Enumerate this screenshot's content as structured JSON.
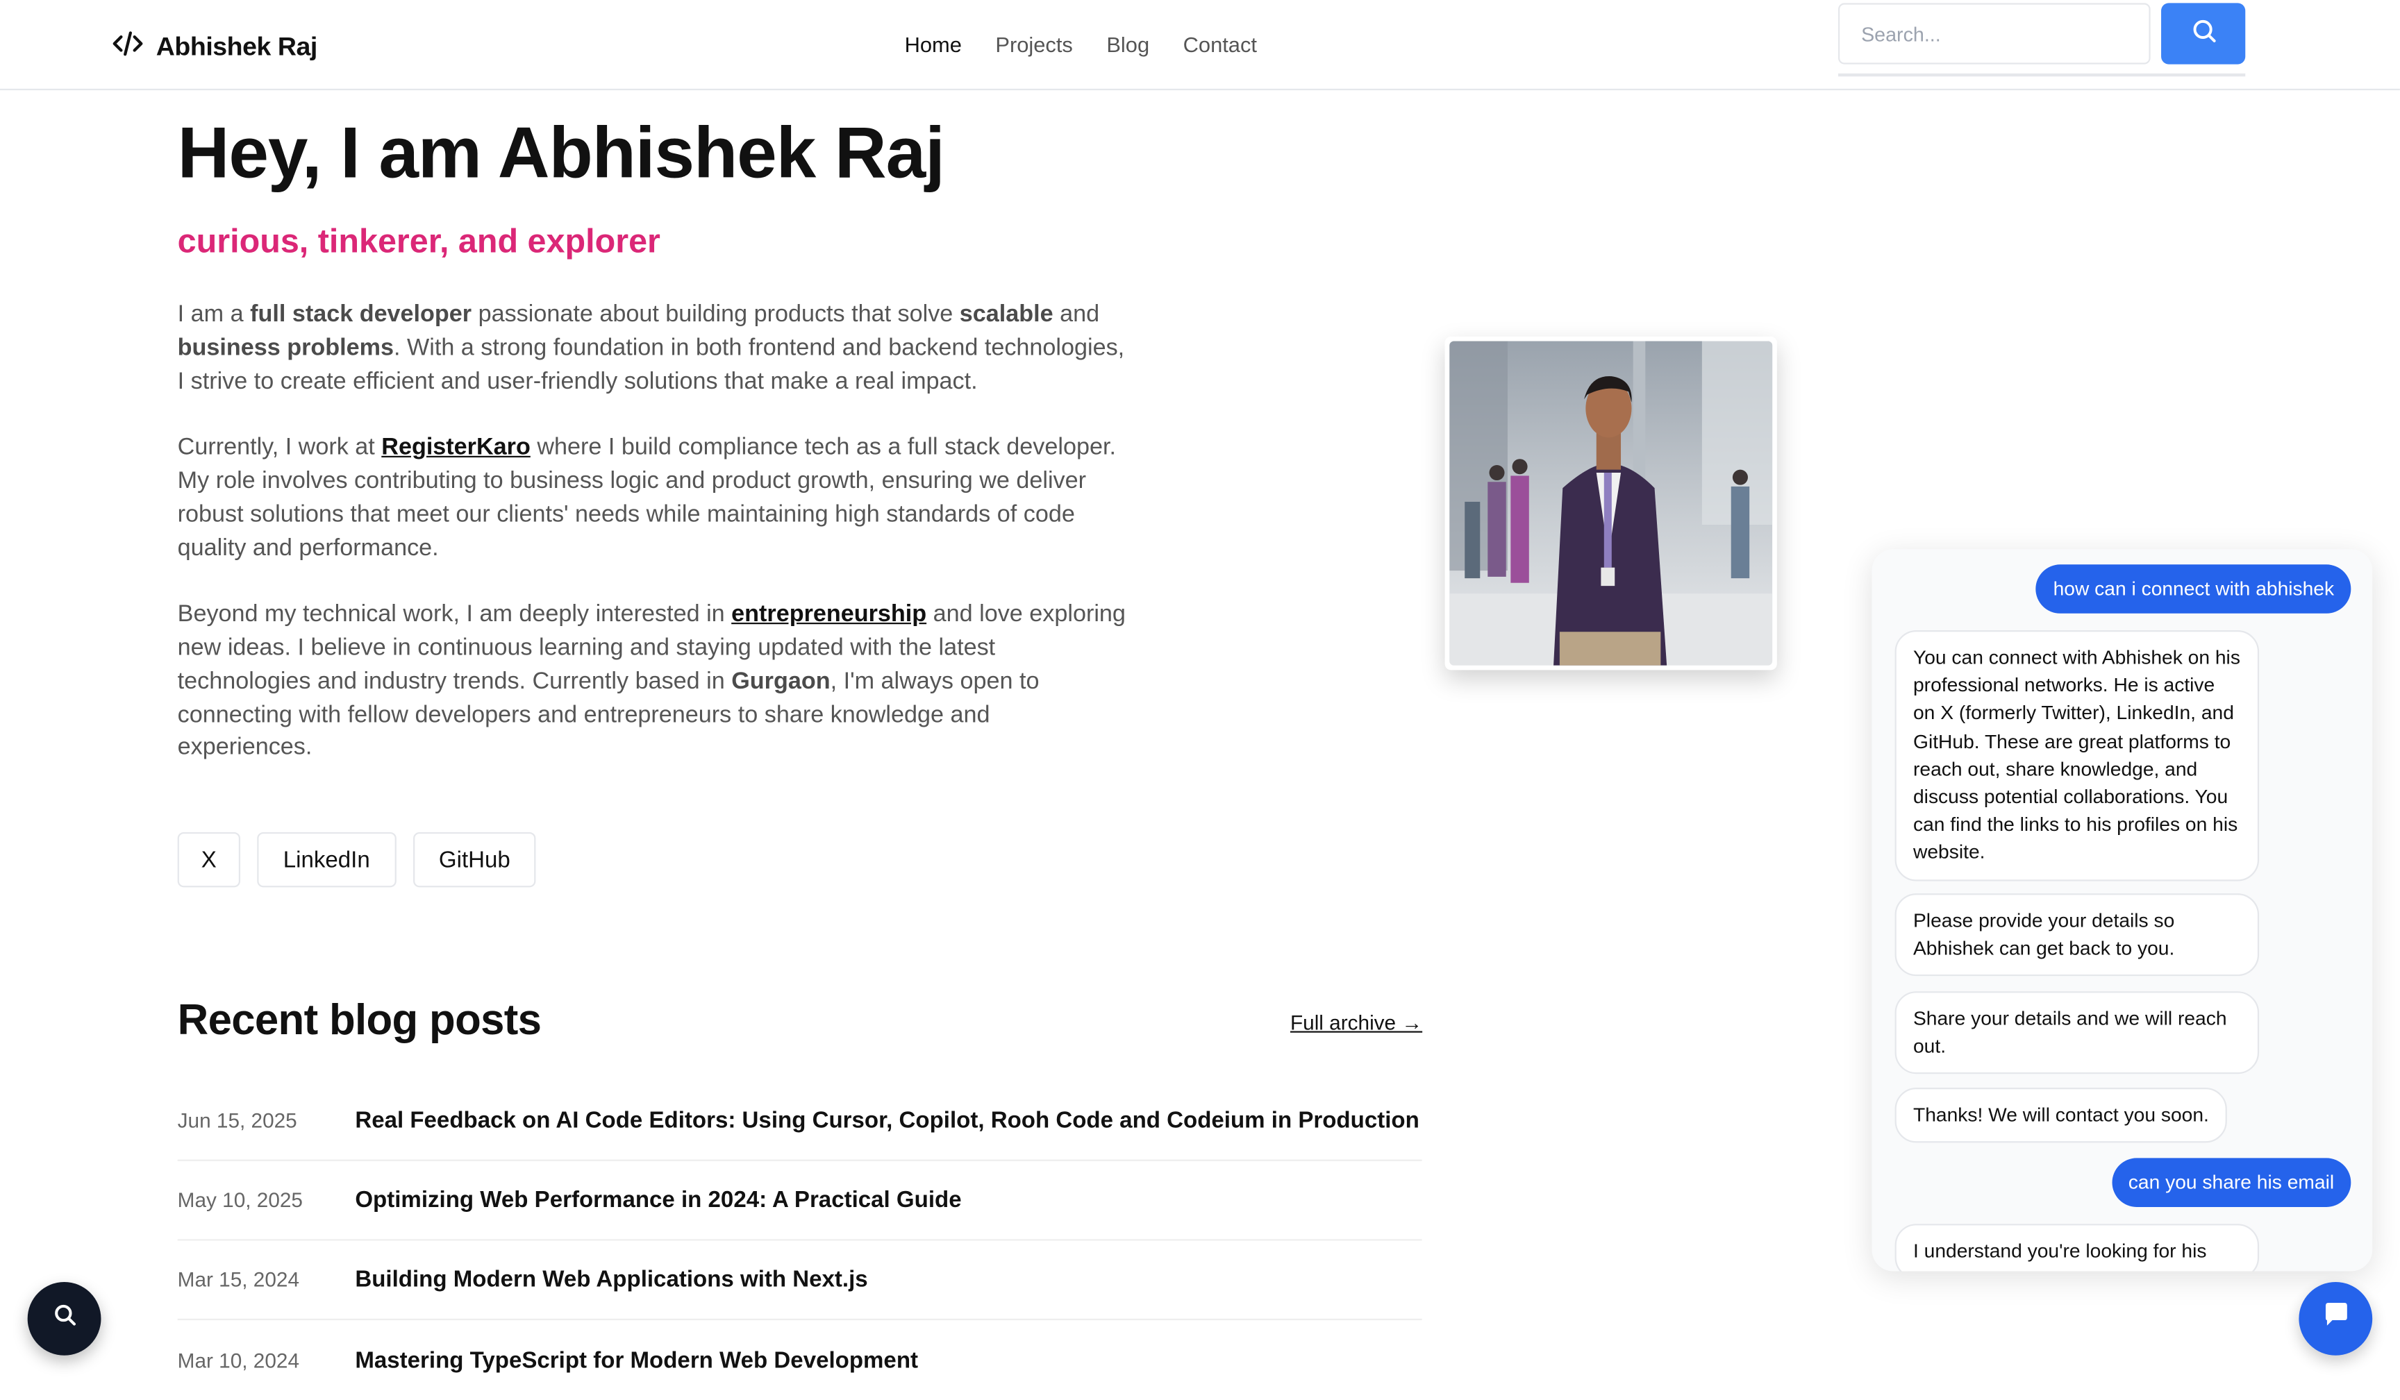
{
  "header": {
    "brand_name": "Abhishek Raj",
    "nav": [
      {
        "label": "Home",
        "active": true
      },
      {
        "label": "Projects",
        "active": false
      },
      {
        "label": "Blog",
        "active": false
      },
      {
        "label": "Contact",
        "active": false
      }
    ],
    "search_placeholder": "Search...",
    "search_icon": "search-icon"
  },
  "hero": {
    "title": "Hey, I am Abhishek Raj",
    "tagline": "curious, tinkerer, and explorer",
    "p1": {
      "t1": "I am a ",
      "b1": "full stack developer",
      "t2": " passionate about building products that solve ",
      "b2": "scalable",
      "t3": " and ",
      "b3": "business problems",
      "t4": ". With a strong foundation in both frontend and backend technologies, I strive to create efficient and user-friendly solutions that make a real impact."
    },
    "p2": {
      "t1": "Currently, I work at ",
      "link": "RegisterKaro",
      "t2": " where I build compliance tech as a full stack developer. My role involves contributing to business logic and product growth, ensuring we deliver robust solutions that meet our clients' needs while maintaining high standards of code quality and performance."
    },
    "p3": {
      "t1": "Beyond my technical work, I am deeply interested in ",
      "link": "entrepreneurship",
      "t2": " and love exploring new ideas. I believe in continuous learning and staying updated with the latest technologies and industry trends. Currently based in ",
      "b1": "Gurgaon",
      "t3": ", I'm always open to connecting with fellow developers and entrepreneurs to share knowledge and experiences."
    },
    "socials": [
      "X",
      "LinkedIn",
      "GitHub"
    ]
  },
  "blog": {
    "title": "Recent blog posts",
    "archive_label": "Full archive →",
    "posts": [
      {
        "date": "Jun 15, 2025",
        "title": "Real Feedback on AI Code Editors: Using Cursor, Copilot, Rooh Code and Codeium in Production"
      },
      {
        "date": "May 10, 2025",
        "title": "Optimizing Web Performance in 2024: A Practical Guide"
      },
      {
        "date": "Mar 15, 2024",
        "title": "Building Modern Web Applications with Next.js"
      },
      {
        "date": "Mar 10, 2024",
        "title": "Mastering TypeScript for Modern Web Development"
      }
    ]
  },
  "chat": {
    "messages": [
      {
        "role": "user",
        "text": "how can i connect with abhishek"
      },
      {
        "role": "bot",
        "text": "You can connect with Abhishek on his professional networks. He is active on X (formerly Twitter), LinkedIn, and GitHub. These are great platforms to reach out, share knowledge, and discuss potential collaborations. You can find the links to his profiles on his website."
      },
      {
        "role": "bot",
        "text": "Please provide your details so Abhishek can get back to you."
      },
      {
        "role": "bot",
        "text": "Share your details and we will reach out."
      },
      {
        "role": "bot",
        "text": "Thanks! We will contact you soon."
      },
      {
        "role": "user",
        "text": "can you share his email"
      },
      {
        "role": "bot",
        "text": "I understand you're looking for his"
      }
    ]
  },
  "colors": {
    "accent": "#3b82f6",
    "chat_blue": "#2563eb",
    "tagline": "#db2777",
    "fab_dark": "#111827"
  },
  "icons": [
    "code-icon",
    "search-icon",
    "chat-icon"
  ]
}
